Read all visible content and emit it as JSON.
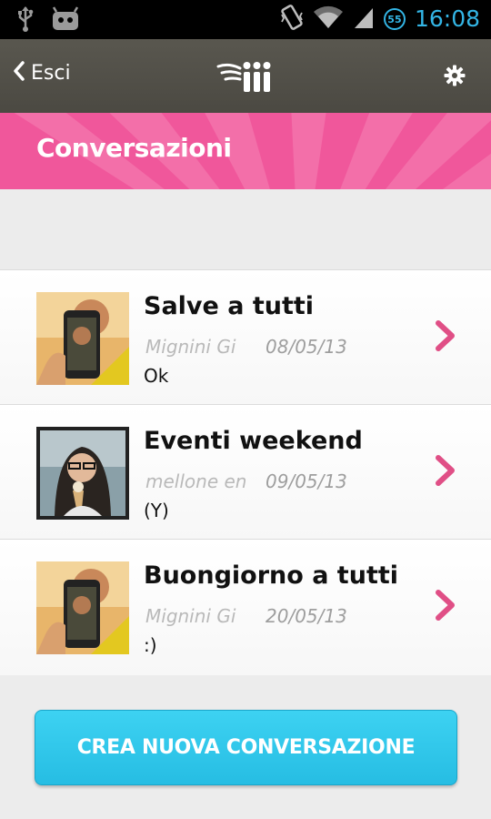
{
  "status_bar": {
    "time": "16:08",
    "battery_level": "55",
    "icons": [
      "usb-icon",
      "android-icon",
      "vibrate-icon",
      "wifi-icon",
      "signal-icon",
      "battery-icon"
    ]
  },
  "app_bar": {
    "back_label": "Esci",
    "logo_icon": "wings-logo-icon",
    "settings_icon": "gear-icon"
  },
  "header": {
    "title": "Conversazioni",
    "color": "#f0579b"
  },
  "conversations": [
    {
      "title": "Salve a tutti",
      "user": "Mignini Gi",
      "date": "08/05/13",
      "preview": "Ok",
      "avatar": "man-with-phone-photo"
    },
    {
      "title": "Eventi weekend",
      "user": "mellone en",
      "date": "09/05/13",
      "preview": "(Y)",
      "avatar": "woman-with-ice-cream-photo"
    },
    {
      "title": "Buongiorno a tutti",
      "user": "Mignini Gi",
      "date": "20/05/13",
      "preview": ":)",
      "avatar": "man-with-phone-photo"
    }
  ],
  "create_button": {
    "label": "CREA NUOVA CONVERSAZIONE",
    "color": "#33c9ec"
  },
  "accent_color": "#e04f86"
}
